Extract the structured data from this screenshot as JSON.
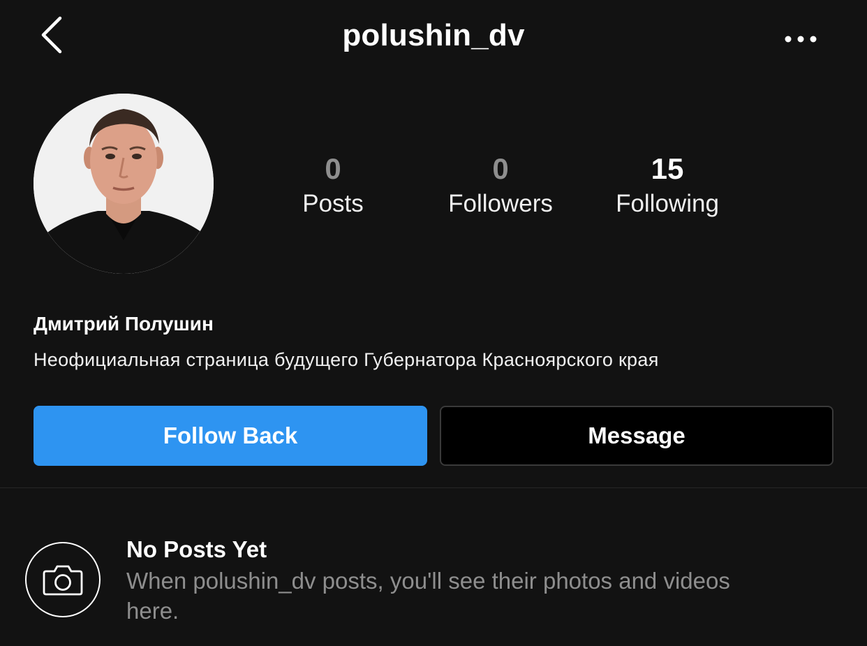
{
  "header": {
    "username": "polushin_dv",
    "back_icon": "chevron-left-icon",
    "more_icon": "more-horizontal-icon"
  },
  "profile": {
    "avatar_alt": "profile photo",
    "stats": [
      {
        "count": "0",
        "label": "Posts"
      },
      {
        "count": "0",
        "label": "Followers"
      },
      {
        "count": "15",
        "label": "Following"
      }
    ],
    "full_name": "Дмитрий Полушин",
    "bio": "Неофициальная страница будущего Губернатора Красноярского края"
  },
  "actions": {
    "follow_back_label": "Follow Back",
    "message_label": "Message"
  },
  "empty_state": {
    "icon": "camera-icon",
    "title": "No Posts Yet",
    "text": "When polushin_dv posts, you'll see their photos and videos here."
  },
  "colors": {
    "background": "#121212",
    "accent": "#2e94f1",
    "muted_text": "#8e8e8e"
  }
}
